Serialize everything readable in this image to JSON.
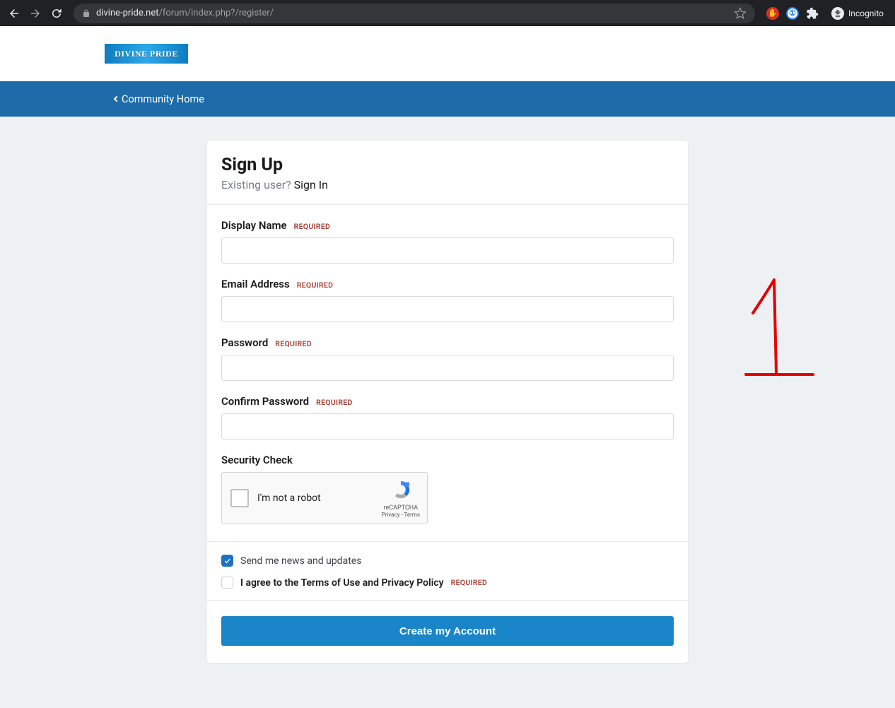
{
  "browser": {
    "url_host": "divine-pride.net",
    "url_path": "/forum/index.php?/register/",
    "incognito_label": "Incognito"
  },
  "logo_text": "DIVINE PRIDE",
  "nav": {
    "community_home": "Community Home"
  },
  "page": {
    "title": "Sign Up",
    "existing_text": "Existing user?",
    "signin_link": "Sign In"
  },
  "fields": {
    "display_name": {
      "label": "Display Name",
      "required": "REQUIRED"
    },
    "email": {
      "label": "Email Address",
      "required": "REQUIRED"
    },
    "password": {
      "label": "Password",
      "required": "REQUIRED"
    },
    "confirm_password": {
      "label": "Confirm Password",
      "required": "REQUIRED"
    },
    "security": {
      "label": "Security Check"
    }
  },
  "recaptcha": {
    "label": "I'm not a robot",
    "brand": "reCAPTCHA",
    "privacy": "Privacy",
    "terms": "Terms"
  },
  "checks": {
    "news": "Send me news and updates",
    "agree_prefix": "I agree to the ",
    "terms_of_use": "Terms of Use",
    "and": " and ",
    "privacy_policy": "Privacy Policy",
    "agree_required": "REQUIRED"
  },
  "submit_label": "Create my Account",
  "annotation": {
    "glyph": "1"
  }
}
